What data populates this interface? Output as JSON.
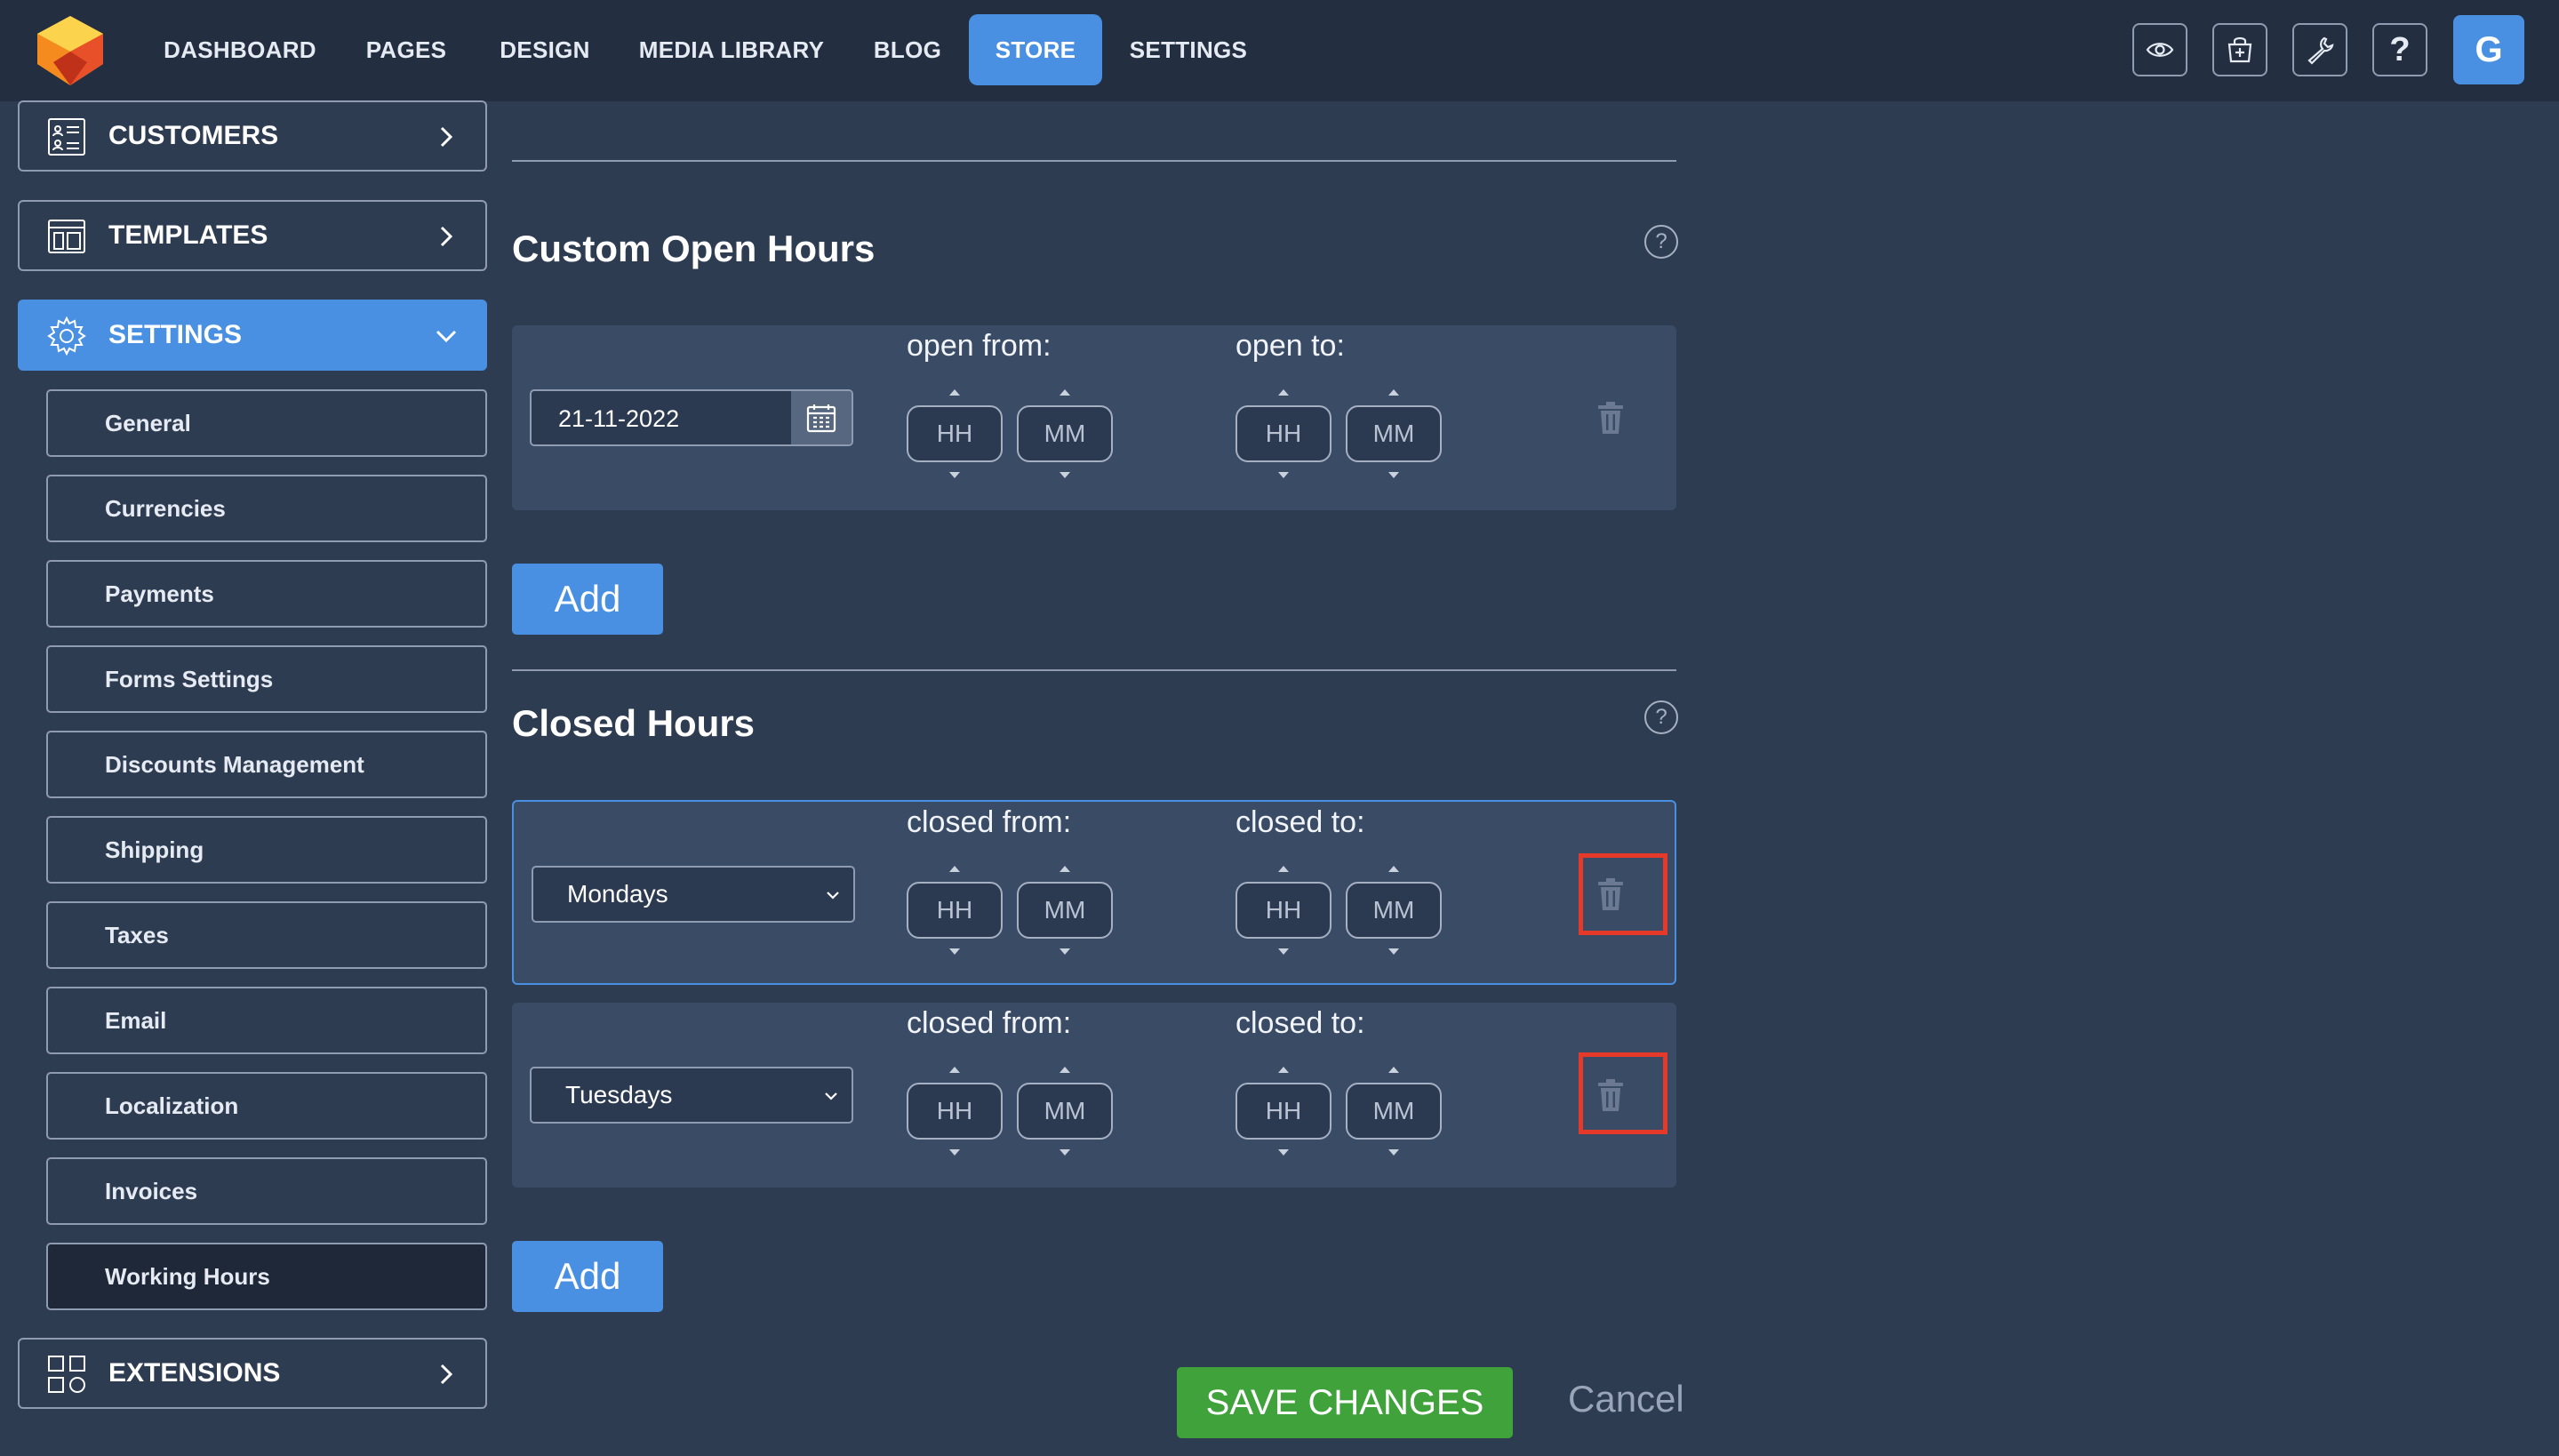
{
  "nav": {
    "items": [
      {
        "label": "DASHBOARD"
      },
      {
        "label": "PAGES"
      },
      {
        "label": "DESIGN"
      },
      {
        "label": "MEDIA LIBRARY"
      },
      {
        "label": "BLOG"
      },
      {
        "label": "STORE",
        "active": true
      },
      {
        "label": "SETTINGS"
      }
    ],
    "tools": [
      "eye-icon",
      "shop-add-icon",
      "wrench-icon",
      "help-icon"
    ],
    "help_glyph": "?",
    "avatar_letter": "G"
  },
  "sidebar": {
    "sections": {
      "customers": {
        "label": "CUSTOMERS",
        "icon": "customers-list-icon"
      },
      "templates": {
        "label": "TEMPLATES",
        "icon": "templates-icon"
      },
      "settings": {
        "label": "SETTINGS",
        "icon": "gear-icon",
        "expanded": true
      },
      "extensions": {
        "label": "EXTENSIONS",
        "icon": "extensions-grid-icon"
      }
    },
    "settings_items": [
      {
        "label": "General"
      },
      {
        "label": "Currencies"
      },
      {
        "label": "Payments"
      },
      {
        "label": "Forms Settings"
      },
      {
        "label": "Discounts Management"
      },
      {
        "label": "Shipping"
      },
      {
        "label": "Taxes"
      },
      {
        "label": "Email"
      },
      {
        "label": "Localization"
      },
      {
        "label": "Invoices"
      },
      {
        "label": "Working Hours",
        "active": true
      }
    ]
  },
  "main": {
    "custom_open": {
      "title": "Custom Open Hours",
      "help": "?",
      "rows": [
        {
          "date": "21-11-2022",
          "from_label": "open from:",
          "to_label": "open to:",
          "from_hh": "HH",
          "from_mm": "MM",
          "to_hh": "HH",
          "to_mm": "MM"
        }
      ],
      "add_label": "Add"
    },
    "closed": {
      "title": "Closed Hours",
      "help": "?",
      "rows": [
        {
          "day": "Mondays",
          "from_label": "closed from:",
          "to_label": "closed to:",
          "from_hh": "HH",
          "from_mm": "MM",
          "to_hh": "HH",
          "to_mm": "MM"
        },
        {
          "day": "Tuesdays",
          "from_label": "closed from:",
          "to_label": "closed to:",
          "from_hh": "HH",
          "from_mm": "MM",
          "to_hh": "HH",
          "to_mm": "MM"
        }
      ],
      "add_label": "Add"
    },
    "save_label": "SAVE CHANGES",
    "cancel_label": "Cancel"
  },
  "colors": {
    "accent": "#4a90e2",
    "save": "#3fa23b",
    "highlight": "#e53a2a",
    "background": "#2e3c52",
    "topbar": "#232e40"
  }
}
